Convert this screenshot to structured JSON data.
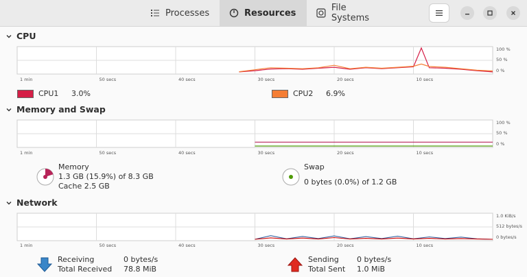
{
  "tabs": [
    {
      "label": "Processes",
      "icon": "list-icon",
      "active": false
    },
    {
      "label": "Resources",
      "icon": "gauge-icon",
      "active": true
    },
    {
      "label": "File Systems",
      "icon": "disk-icon",
      "active": false
    }
  ],
  "sections": {
    "cpu": "CPU",
    "memory": "Memory and Swap",
    "network": "Network"
  },
  "x_axis": [
    "1 min",
    "50 secs",
    "40 secs",
    "30 secs",
    "20 secs",
    "10 secs"
  ],
  "percent_axis": [
    "100 %",
    "50 %",
    "0 %"
  ],
  "network_axis": [
    "1.0 KiB/s",
    "512 bytes/s",
    "0 bytes/s"
  ],
  "cpu_legend": [
    {
      "name": "CPU1",
      "value": "3.0%",
      "color": "#d51f47"
    },
    {
      "name": "CPU2",
      "value": "6.9%",
      "color": "#f57e35"
    }
  ],
  "memory": {
    "label": "Memory",
    "detail": "1.3 GB (15.9%) of 8.3 GB",
    "cache": "Cache 2.5 GB",
    "color": "#b72459"
  },
  "swap": {
    "label": "Swap",
    "detail": "0 bytes (0.0%) of 1.2 GB",
    "color": "#4e9a06"
  },
  "network": {
    "receiving_label": "Receiving",
    "receiving_value": "0 bytes/s",
    "total_received_label": "Total Received",
    "total_received_value": "78.8 MiB",
    "sending_label": "Sending",
    "sending_value": "0 bytes/s",
    "total_sent_label": "Total Sent",
    "total_sent_value": "1.0 MiB"
  },
  "chart_data": [
    {
      "type": "line",
      "x": [
        -32,
        -30,
        -28,
        -26,
        -24,
        -22,
        -20,
        -18,
        -16,
        -14,
        -12,
        -10,
        -9,
        -8,
        -6,
        -4,
        -2,
        0
      ],
      "series": [
        {
          "name": "CPU1",
          "values": [
            3,
            8,
            15,
            16,
            14,
            18,
            22,
            14,
            20,
            16,
            20,
            24,
            100,
            20,
            18,
            14,
            8,
            3
          ]
        },
        {
          "name": "CPU2",
          "values": [
            4,
            12,
            20,
            18,
            16,
            20,
            30,
            16,
            22,
            18,
            22,
            26,
            35,
            25,
            22,
            16,
            10,
            7
          ]
        }
      ],
      "ylim": [
        0,
        100
      ]
    },
    {
      "type": "line",
      "x": [
        -30,
        0
      ],
      "series": [
        {
          "name": "Memory",
          "values": [
            15.9,
            15.9
          ]
        },
        {
          "name": "Swap",
          "values": [
            0,
            0
          ]
        }
      ],
      "ylim": [
        0,
        100
      ]
    },
    {
      "type": "line",
      "x": [
        -30,
        -28,
        -26,
        -24,
        -22,
        -20,
        -18,
        -16,
        -14,
        -12,
        -10,
        -8,
        -6,
        -4,
        -2,
        0
      ],
      "series": [
        {
          "name": "Receiving",
          "values": [
            0,
            150,
            20,
            120,
            30,
            140,
            20,
            110,
            30,
            130,
            20,
            100,
            30,
            90,
            20,
            0
          ]
        },
        {
          "name": "Sending",
          "values": [
            0,
            60,
            10,
            50,
            10,
            70,
            10,
            40,
            10,
            50,
            10,
            40,
            10,
            30,
            10,
            0
          ]
        }
      ],
      "ylim": [
        0,
        1024
      ]
    }
  ]
}
